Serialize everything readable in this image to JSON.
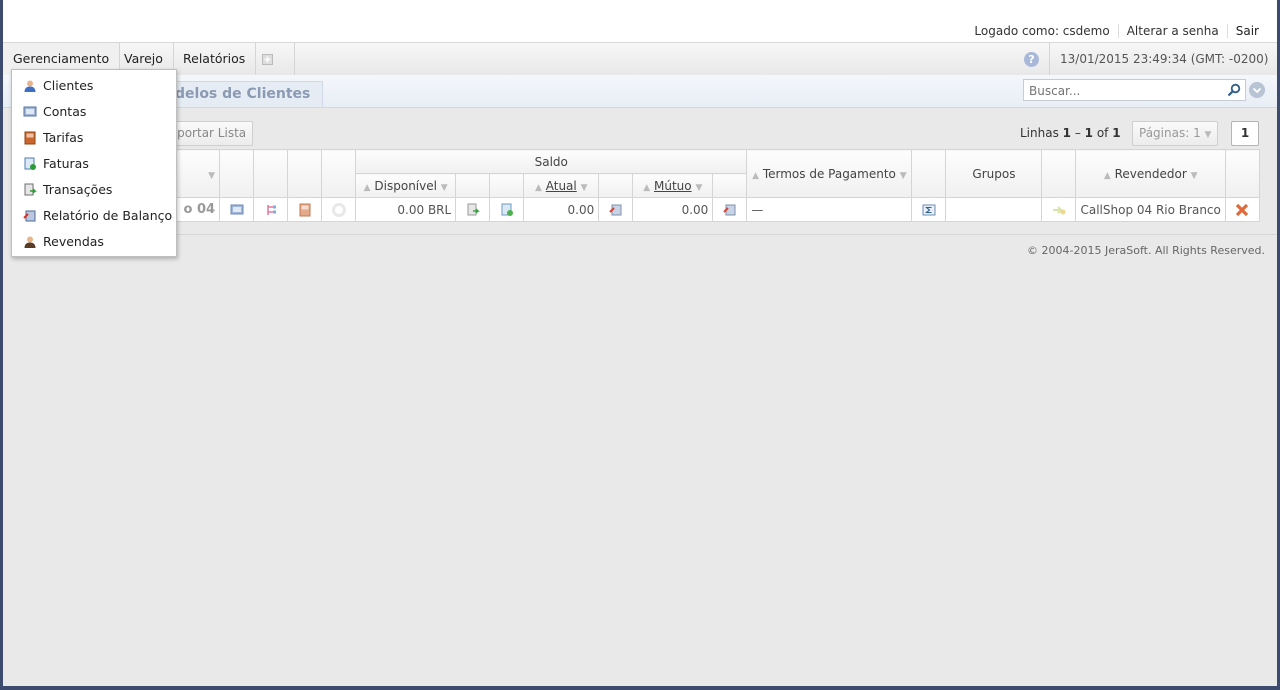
{
  "header": {
    "logged_as": "Logado como: csdemo",
    "change_password": "Alterar a senha",
    "logout": "Sair"
  },
  "menu": {
    "items": [
      "Gerenciamento",
      "Varejo",
      "Relatórios"
    ],
    "datetime": "13/01/2015 23:49:34 (GMT: -0200)"
  },
  "dropdown": {
    "items": [
      {
        "label": "Clientes",
        "icon": "user-icon"
      },
      {
        "label": "Contas",
        "icon": "accounts-icon"
      },
      {
        "label": "Tarifas",
        "icon": "book-icon"
      },
      {
        "label": "Faturas",
        "icon": "invoice-icon"
      },
      {
        "label": "Transações",
        "icon": "transaction-icon"
      },
      {
        "label": "Relatório de Balanço",
        "icon": "balance-report-icon"
      },
      {
        "label": "Revendas",
        "icon": "reseller-icon"
      }
    ]
  },
  "page": {
    "tab_title": "delos de Clientes",
    "search_placeholder": "Buscar...",
    "export_label": "xportar Lista",
    "lines_prefix": "Linhas ",
    "lines_from": "1",
    "lines_dash": " – ",
    "lines_to": "1",
    "lines_of": " of ",
    "lines_total": "1",
    "pages_label": "Páginas: 1",
    "current_page": "1"
  },
  "table": {
    "saldo": "Saldo",
    "disponivel": "Disponível",
    "atual": "Atual",
    "mutuo": "Mútuo",
    "termos": "Termos de Pagamento",
    "grupos": "Grupos",
    "revendedor": "Revendedor",
    "row": {
      "name": "o 04",
      "disponivel": "0.00 BRL",
      "atual": "0.00",
      "mutuo": "0.00",
      "termos": "—",
      "revendedor": "CallShop 04 Rio Branco"
    }
  },
  "footer": {
    "copyright": "© 2004-2015 JeraSoft. All Rights Reserved."
  },
  "colors": {
    "accent": "#3c4b6e",
    "delete": "#e06a3a"
  }
}
